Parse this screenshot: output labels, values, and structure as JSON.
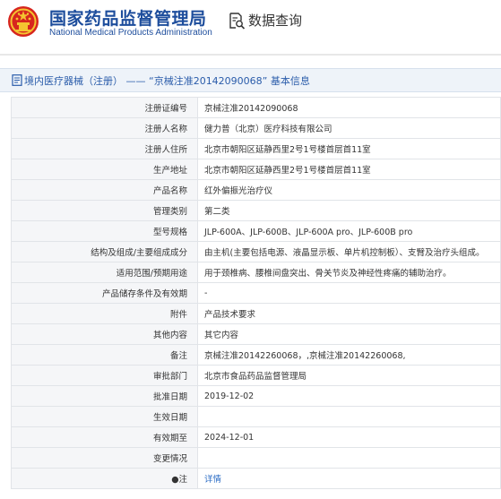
{
  "header": {
    "title": "国家药品监督管理局",
    "subtitle": "National Medical Products Administration",
    "nav_label": "数据查询",
    "icons": {
      "emblem": "national-emblem",
      "nav": "search-document-icon"
    },
    "brand_color": "#1d4d9c"
  },
  "panel": {
    "title": "境内医疗器械（注册） —— “京械注准20142090068” 基本信息",
    "icon": "document-icon"
  },
  "rows": [
    {
      "label": "注册证编号",
      "value": "京械注准20142090068"
    },
    {
      "label": "注册人名称",
      "value": "健力普（北京）医疗科技有限公司"
    },
    {
      "label": "注册人住所",
      "value": "北京市朝阳区延静西里2号1号楼首层首11室"
    },
    {
      "label": "生产地址",
      "value": "北京市朝阳区延静西里2号1号楼首层首11室"
    },
    {
      "label": "产品名称",
      "value": "红外偏振光治疗仪"
    },
    {
      "label": "管理类别",
      "value": "第二类"
    },
    {
      "label": "型号规格",
      "value": "JLP-600A、JLP-600B、JLP-600A pro、JLP-600B pro"
    },
    {
      "label": "结构及组成/主要组成成分",
      "value": "由主机(主要包括电源、液晶显示板、单片机控制板）、支臂及治疗头组成。"
    },
    {
      "label": "适用范围/预期用途",
      "value": "用于颈椎病、腰椎间盘突出、骨关节炎及神经性疼痛的辅助治疗。"
    },
    {
      "label": "产品储存条件及有效期",
      "value": "-"
    },
    {
      "label": "附件",
      "value": "产品技术要求"
    },
    {
      "label": "其他内容",
      "value": "其它内容"
    },
    {
      "label": "备注",
      "value": "京械注准20142260068，,京械注准20142260068,"
    },
    {
      "label": "审批部门",
      "value": "北京市食品药品监督管理局"
    },
    {
      "label": "批准日期",
      "value": "2019-12-02"
    },
    {
      "label": "生效日期",
      "value": ""
    },
    {
      "label": "有效期至",
      "value": "2024-12-01"
    },
    {
      "label": "变更情况",
      "value": ""
    },
    {
      "label": "●注",
      "value": "详情"
    }
  ]
}
